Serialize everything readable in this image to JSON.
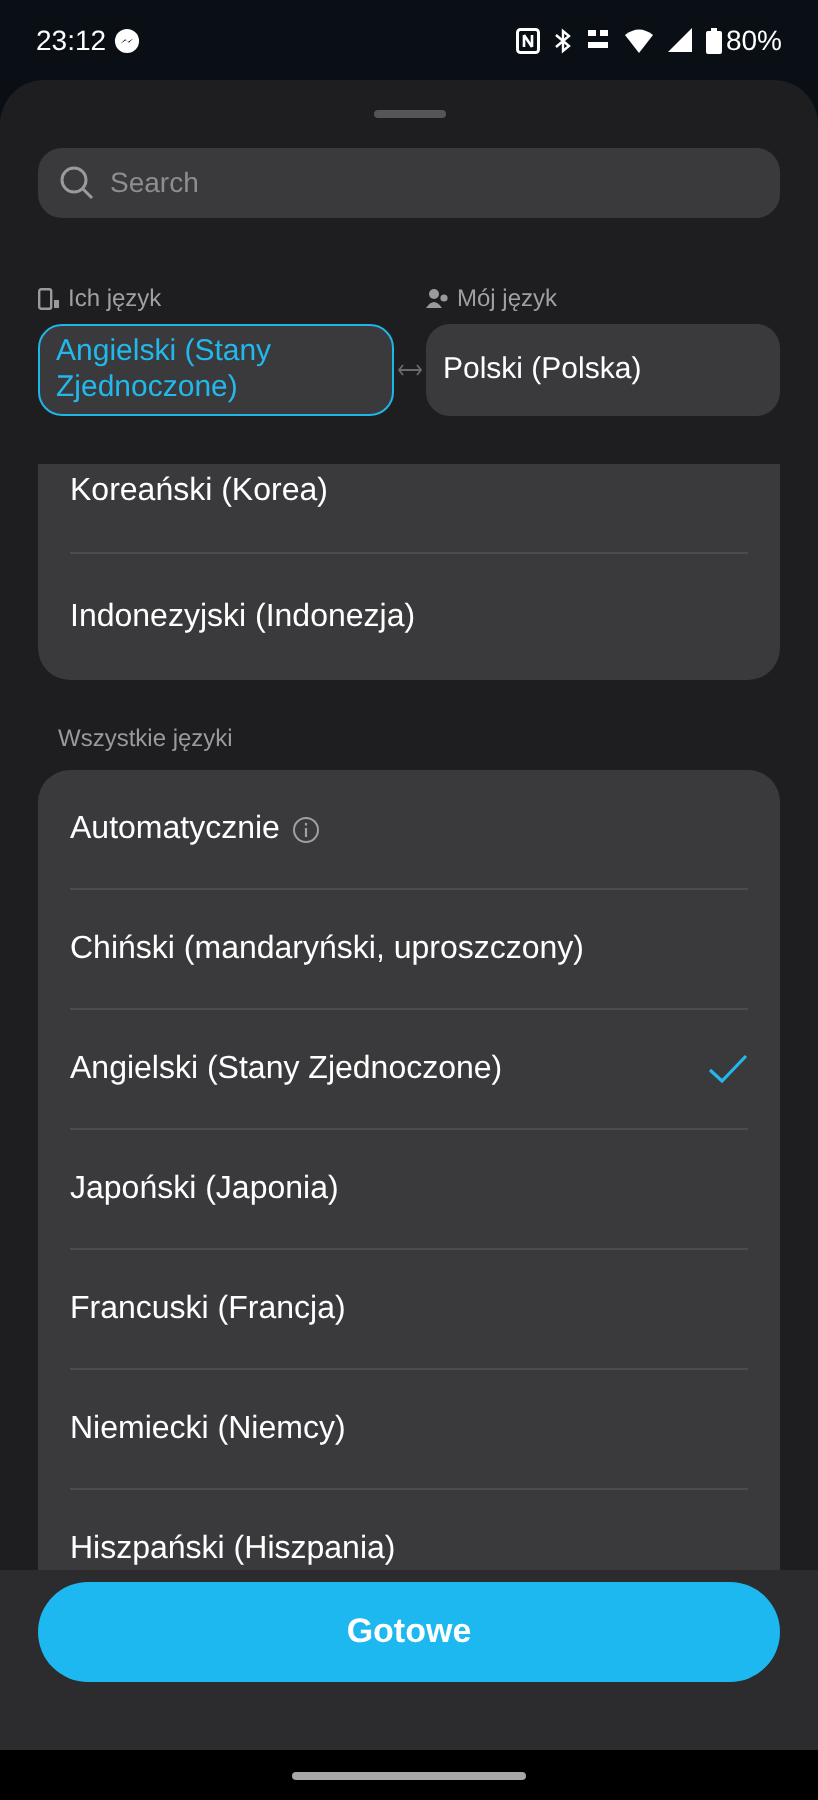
{
  "status_bar": {
    "time": "23:12",
    "battery": "80%"
  },
  "search": {
    "placeholder": "Search"
  },
  "their_language": {
    "label": "Ich język",
    "value": "Angielski (Stany Zjednoczone)",
    "selected": true
  },
  "my_language": {
    "label": "Mój język",
    "value": "Polski (Polska)",
    "selected": false
  },
  "recent_languages": [
    {
      "name": "Koreański (Korea)"
    },
    {
      "name": "Indonezyjski (Indonezja)"
    }
  ],
  "all_languages": {
    "title": "Wszystkie języki",
    "items": [
      {
        "name": "Automatycznie",
        "info": true,
        "checked": false
      },
      {
        "name": "Chiński (mandaryński, uproszczony)",
        "info": false,
        "checked": false
      },
      {
        "name": "Angielski (Stany Zjednoczone)",
        "info": false,
        "checked": true
      },
      {
        "name": "Japoński (Japonia)",
        "info": false,
        "checked": false
      },
      {
        "name": "Francuski (Francja)",
        "info": false,
        "checked": false
      },
      {
        "name": "Niemiecki (Niemcy)",
        "info": false,
        "checked": false
      },
      {
        "name": "Hiszpański (Hiszpania)",
        "info": false,
        "checked": false
      }
    ]
  },
  "done_button": "Gotowe"
}
